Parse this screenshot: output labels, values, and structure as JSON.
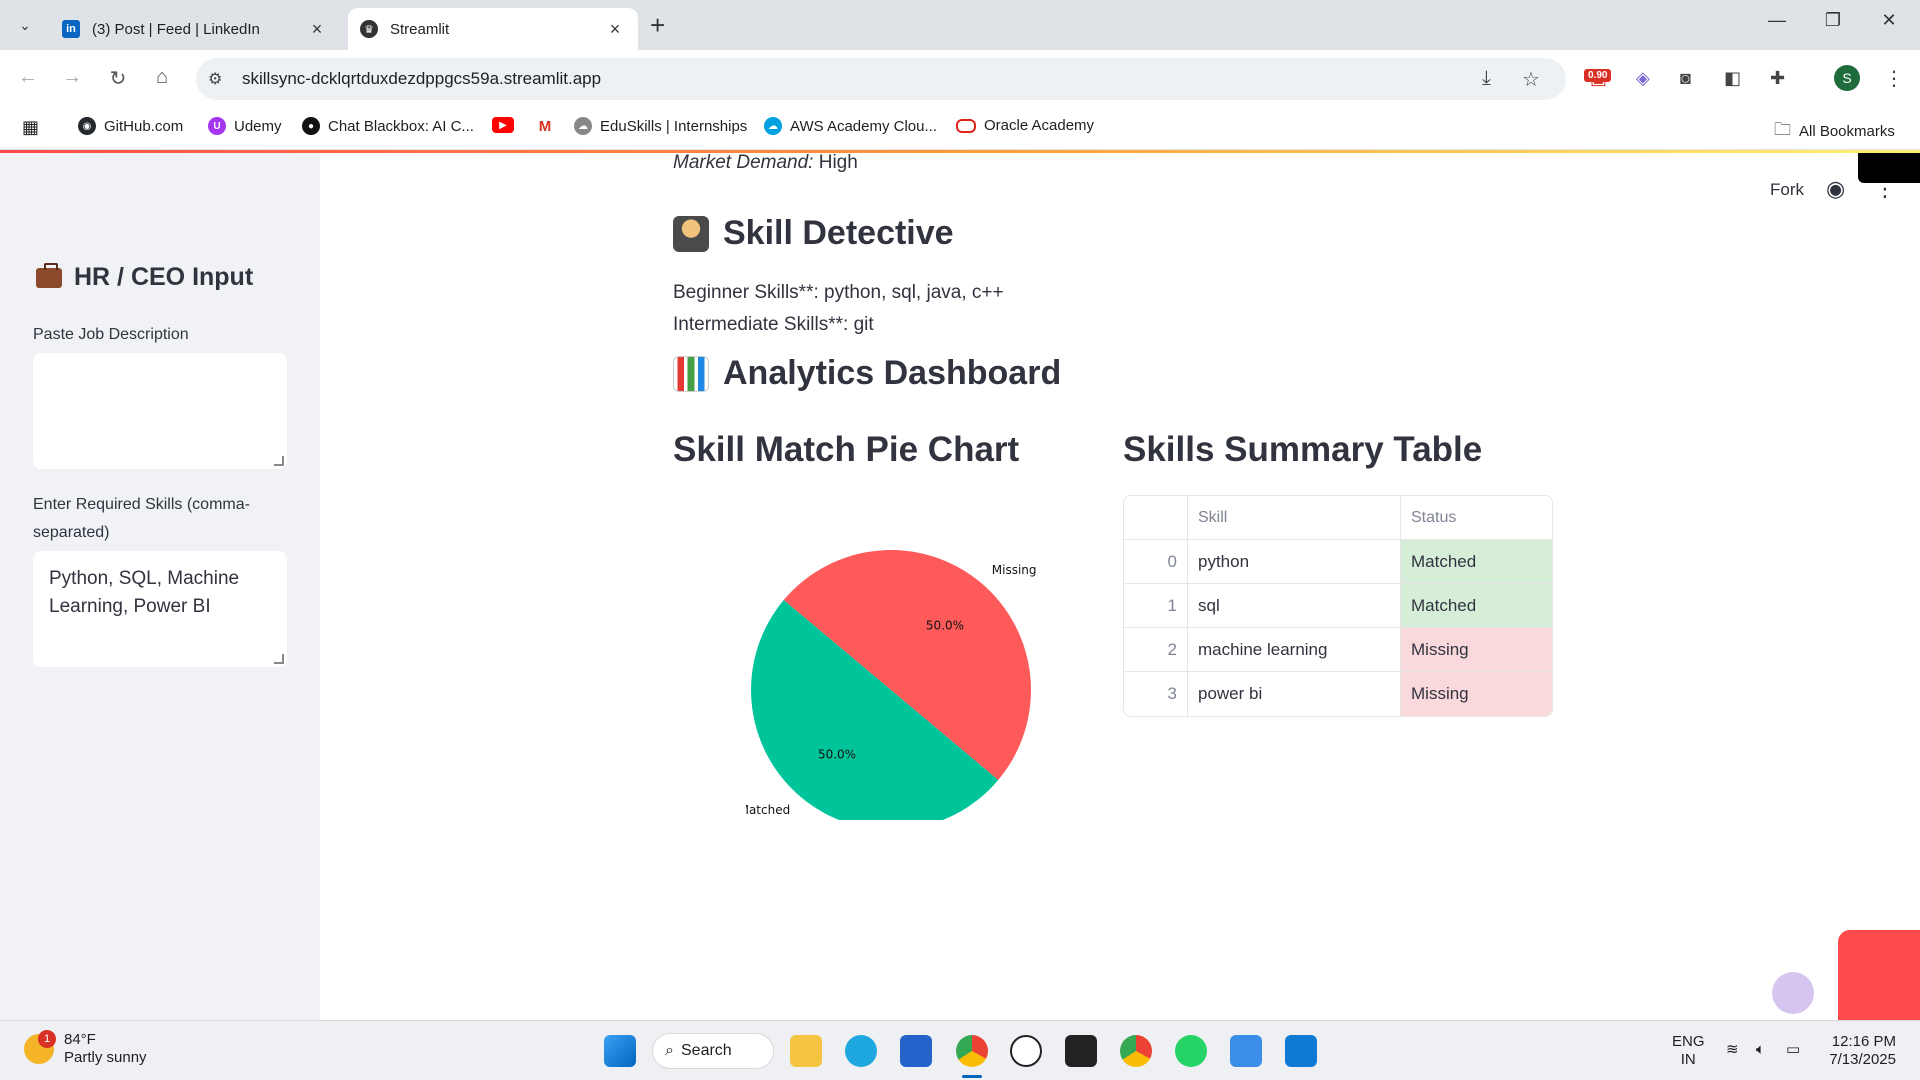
{
  "browser": {
    "tabs": [
      {
        "title": "(3) Post | Feed | LinkedIn",
        "active": false,
        "favicon": "linkedin-icon"
      },
      {
        "title": "Streamlit",
        "active": true,
        "favicon": "streamlit-icon"
      }
    ],
    "url": "skillsync-dcklqrtduxdezdppgcs59a.streamlit.app",
    "extension_badge": "0.90",
    "profile_initial": "S",
    "bookmarks": [
      {
        "label": "GitHub.com",
        "icon": "github-icon"
      },
      {
        "label": "Udemy",
        "icon": "udemy-icon"
      },
      {
        "label": "Chat Blackbox: AI C...",
        "icon": "blackbox-icon"
      },
      {
        "label": "",
        "icon": "youtube-icon"
      },
      {
        "label": "",
        "icon": "gmail-icon"
      },
      {
        "label": "EduSkills | Internships",
        "icon": "eduskills-icon"
      },
      {
        "label": "AWS Academy Clou...",
        "icon": "salesforce-icon"
      },
      {
        "label": "Oracle Academy",
        "icon": "oracle-icon"
      }
    ],
    "all_bookmarks": "All Bookmarks"
  },
  "sidebar": {
    "title": "HR / CEO Input",
    "jd_label": "Paste Job Description",
    "jd_value": "",
    "skills_label": "Enter Required Skills (comma-separated)",
    "skills_value": "Python, SQL, Machine Learning, Power BI"
  },
  "header": {
    "fork": "Fork"
  },
  "main": {
    "market_label": "Market Demand:",
    "market_value": "High",
    "detective_title": "Skill Detective",
    "beginner_line": "Beginner Skills**: python, sql, java, c++",
    "intermediate_line": "Intermediate Skills**: git",
    "analytics_title": "Analytics Dashboard",
    "pie_title": "Skill Match Pie Chart",
    "table_title": "Skills Summary Table"
  },
  "chart_data": {
    "type": "pie",
    "labels": [
      "Missing",
      "Matched"
    ],
    "values": [
      50.0,
      50.0
    ],
    "percent_labels": [
      "50.0%",
      "50.0%"
    ],
    "colors": [
      "#ff5a5a",
      "#00c49a"
    ]
  },
  "table": {
    "columns": [
      "",
      "Skill",
      "Status"
    ],
    "rows": [
      {
        "index": "0",
        "skill": "python",
        "status": "Matched"
      },
      {
        "index": "1",
        "skill": "sql",
        "status": "Matched"
      },
      {
        "index": "2",
        "skill": "machine learning",
        "status": "Missing"
      },
      {
        "index": "3",
        "skill": "power bi",
        "status": "Missing"
      }
    ]
  },
  "taskbar": {
    "temperature": "84°F",
    "weather": "Partly sunny",
    "weather_badge": "1",
    "search": "Search",
    "lang_line1": "ENG",
    "lang_line2": "IN",
    "time": "12:16 PM",
    "date": "7/13/2025"
  }
}
